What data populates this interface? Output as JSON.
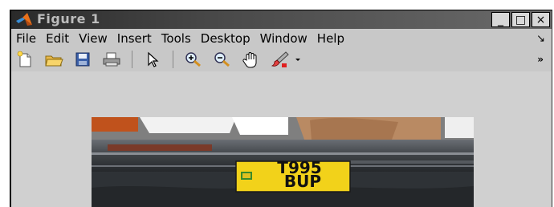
{
  "window": {
    "title": "Figure 1",
    "controls": {
      "minimize": "_",
      "maximize": "□",
      "close": "×"
    }
  },
  "menubar": {
    "items": [
      "File",
      "Edit",
      "View",
      "Insert",
      "Tools",
      "Desktop",
      "Window",
      "Help"
    ],
    "overflow": "↘"
  },
  "toolbar": {
    "buttons": [
      "new-figure-icon",
      "open-file-icon",
      "save-icon",
      "print-icon",
      "select-arrow-icon",
      "zoom-in-icon",
      "zoom-out-icon",
      "pan-hand-icon",
      "data-brush-icon",
      "dropdown-arrow-icon"
    ],
    "overflow": "»"
  },
  "image": {
    "plate_line1": "T995",
    "plate_line2": "BUP"
  }
}
